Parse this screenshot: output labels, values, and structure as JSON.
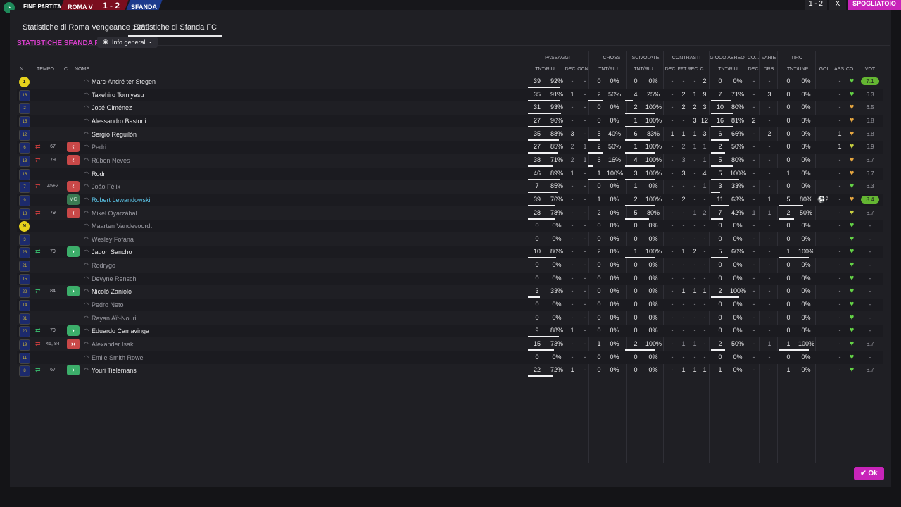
{
  "topbar": {
    "label": "FINE PARTITA",
    "home": "ROMA V",
    "score": "1 - 2",
    "away": "SFANDA",
    "right_score": "1 - 2",
    "right_x": "X",
    "right_btn": "SPOGLIATOIO"
  },
  "tabs": [
    {
      "label": "Statistiche di Roma Vengeance 1989",
      "active": false
    },
    {
      "label": "Statistiche di Sfanda FC",
      "active": true
    }
  ],
  "section_title": "STATISTICHE SFANDA FC",
  "dropdown_label": "Info generali",
  "group_headers": [
    "PASSAGGI",
    "CROSS",
    "SCIVOLATE",
    "CONTRASTI",
    "GIOCO AEREO",
    "CO...",
    "VARIE",
    "TIRO"
  ],
  "column_headers": {
    "n": "N.",
    "tempo": "TEMPO",
    "c": "C",
    "nome": "NOME",
    "pass_tr": "TNT/RIU",
    "pass_dec": "DEC",
    "pass_ocn": "OCN",
    "cross_tr": "TNT/RIU",
    "sciv_tr": "TNT/RIU",
    "con_dec": "DEC",
    "con_fft": "FFT",
    "con_rec": "REC",
    "con_c": "C...",
    "aer_tr": "TNT/RIU",
    "co_dec": "DEC",
    "var_drb": "DRB",
    "tiro_tr": "TNT/UNP",
    "gol": "GOL",
    "ass": "ASS",
    "co": "CO...",
    "voto": "VOT"
  },
  "players": [
    {
      "num": "1",
      "gk": true,
      "tempo": "",
      "sub": "",
      "badge": "",
      "name": "Marc-André ter Stegen",
      "style": "",
      "pt": "39",
      "pp": "92%",
      "pdec": "-",
      "pocn": "-",
      "ct": "0",
      "cp": "0%",
      "st": "0",
      "sp": "0%",
      "c1": "-",
      "c2": "-",
      "c3": "-",
      "c4": "2",
      "at": "0",
      "ap": "0%",
      "cdec": "-",
      "drb": "-",
      "tt": "0",
      "tp": "0%",
      "gol": "",
      "ass": "-",
      "heart": "#64d246",
      "voto": "7.1",
      "best": true,
      "pbar": 0.92,
      "cbar": 0,
      "sbar": 0,
      "abar": 0,
      "tbar": 0
    },
    {
      "num": "18",
      "gk": false,
      "tempo": "",
      "sub": "",
      "badge": "",
      "name": "Takehiro Tomiyasu",
      "style": "",
      "pt": "35",
      "pp": "91%",
      "pdec": "1",
      "pocn": "-",
      "ct": "2",
      "cp": "50%",
      "st": "4",
      "sp": "25%",
      "c1": "-",
      "c2": "2",
      "c3": "1",
      "c4": "9",
      "at": "7",
      "ap": "71%",
      "cdec": "-",
      "drb": "3",
      "tt": "0",
      "tp": "0%",
      "gol": "",
      "ass": "-",
      "heart": "#64d246",
      "voto": "6.3",
      "best": false,
      "pbar": 0.91,
      "cbar": 0.5,
      "sbar": 0.25,
      "abar": 0.71,
      "tbar": 0
    },
    {
      "num": "2",
      "gk": false,
      "tempo": "",
      "sub": "",
      "badge": "",
      "name": "José Giménez",
      "style": "",
      "pt": "31",
      "pp": "93%",
      "pdec": "-",
      "pocn": "-",
      "ct": "0",
      "cp": "0%",
      "st": "2",
      "sp": "100%",
      "c1": "-",
      "c2": "2",
      "c3": "2",
      "c4": "3",
      "at": "10",
      "ap": "80%",
      "cdec": "-",
      "drb": "-",
      "tt": "0",
      "tp": "0%",
      "gol": "",
      "ass": "-",
      "heart": "#e6a640",
      "voto": "6.5",
      "best": false,
      "pbar": 0.93,
      "cbar": 0,
      "sbar": 1,
      "abar": 0.8,
      "tbar": 0
    },
    {
      "num": "15",
      "gk": false,
      "tempo": "",
      "sub": "",
      "badge": "",
      "name": "Alessandro Bastoni",
      "style": "",
      "pt": "27",
      "pp": "96%",
      "pdec": "-",
      "pocn": "-",
      "ct": "0",
      "cp": "0%",
      "st": "1",
      "sp": "100%",
      "c1": "-",
      "c2": "-",
      "c3": "3",
      "c4": "12",
      "at": "16",
      "ap": "81%",
      "cdec": "2",
      "drb": "-",
      "tt": "0",
      "tp": "0%",
      "gol": "",
      "ass": "-",
      "heart": "#e6a640",
      "voto": "6.8",
      "best": false,
      "pbar": 0.96,
      "cbar": 0,
      "sbar": 1,
      "abar": 0.81,
      "tbar": 0
    },
    {
      "num": "12",
      "gk": false,
      "tempo": "",
      "sub": "",
      "badge": "",
      "name": "Sergio Reguilón",
      "style": "",
      "pt": "35",
      "pp": "88%",
      "pdec": "3",
      "pocn": "-",
      "ct": "5",
      "cp": "40%",
      "st": "6",
      "sp": "83%",
      "c1": "1",
      "c2": "1",
      "c3": "1",
      "c4": "3",
      "at": "6",
      "ap": "66%",
      "cdec": "-",
      "drb": "2",
      "tt": "0",
      "tp": "0%",
      "gol": "",
      "ass": "1",
      "heart": "#e6a640",
      "voto": "6.8",
      "best": false,
      "pbar": 0.88,
      "cbar": 0.4,
      "sbar": 0.83,
      "abar": 0.66,
      "tbar": 0
    },
    {
      "num": "6",
      "gk": false,
      "tempo": "67",
      "sub": "out",
      "badge": "out",
      "name": "Pedri",
      "style": "dim",
      "pt": "27",
      "pp": "85%",
      "pdec": "2",
      "pocn": "1",
      "ct": "2",
      "cp": "50%",
      "st": "1",
      "sp": "100%",
      "c1": "-",
      "c2": "2",
      "c3": "1",
      "c4": "1",
      "at": "2",
      "ap": "50%",
      "cdec": "-",
      "drb": "-",
      "tt": "0",
      "tp": "0%",
      "gol": "",
      "ass": "1",
      "heart": "#c8d040",
      "voto": "6.9",
      "best": false,
      "pbar": 0.85,
      "cbar": 0.5,
      "sbar": 1,
      "abar": 0.5,
      "tbar": 0
    },
    {
      "num": "13",
      "gk": false,
      "tempo": "79",
      "sub": "out",
      "badge": "out",
      "name": "Rúben Neves",
      "style": "dim",
      "pt": "38",
      "pp": "71%",
      "pdec": "2",
      "pocn": "1",
      "ct": "6",
      "cp": "16%",
      "st": "4",
      "sp": "100%",
      "c1": "-",
      "c2": "3",
      "c3": "-",
      "c4": "1",
      "at": "5",
      "ap": "80%",
      "cdec": "-",
      "drb": "-",
      "tt": "0",
      "tp": "0%",
      "gol": "",
      "ass": "-",
      "heart": "#e6a640",
      "voto": "6.7",
      "best": false,
      "pbar": 0.71,
      "cbar": 0.16,
      "sbar": 1,
      "abar": 0.8,
      "tbar": 0
    },
    {
      "num": "16",
      "gk": false,
      "tempo": "",
      "sub": "",
      "badge": "",
      "name": "Rodri",
      "style": "",
      "pt": "46",
      "pp": "89%",
      "pdec": "1",
      "pocn": "-",
      "ct": "1",
      "cp": "100%",
      "st": "3",
      "sp": "100%",
      "c1": "-",
      "c2": "3",
      "c3": "-",
      "c4": "4",
      "at": "5",
      "ap": "100%",
      "cdec": "-",
      "drb": "-",
      "tt": "1",
      "tp": "0%",
      "gol": "",
      "ass": "-",
      "heart": "#e6a640",
      "voto": "6.7",
      "best": false,
      "pbar": 0.89,
      "cbar": 1,
      "sbar": 1,
      "abar": 1,
      "tbar": 0
    },
    {
      "num": "7",
      "gk": false,
      "tempo": "45+2",
      "sub": "out",
      "badge": "out",
      "name": "João Félix",
      "style": "dim",
      "pt": "7",
      "pp": "85%",
      "pdec": "-",
      "pocn": "-",
      "ct": "0",
      "cp": "0%",
      "st": "1",
      "sp": "0%",
      "c1": "-",
      "c2": "-",
      "c3": "-",
      "c4": "1",
      "at": "3",
      "ap": "33%",
      "cdec": "-",
      "drb": "-",
      "tt": "0",
      "tp": "0%",
      "gol": "",
      "ass": "-",
      "heart": "#64d246",
      "voto": "6.3",
      "best": false,
      "pbar": 0.85,
      "cbar": 0,
      "sbar": 0,
      "abar": 0.33,
      "tbar": 0
    },
    {
      "num": "9",
      "gk": false,
      "tempo": "",
      "sub": "",
      "badge": "mc",
      "name": "Robert Lewandowski",
      "style": "hl",
      "pt": "39",
      "pp": "76%",
      "pdec": "-",
      "pocn": "-",
      "ct": "1",
      "cp": "0%",
      "st": "2",
      "sp": "100%",
      "c1": "-",
      "c2": "2",
      "c3": "-",
      "c4": "-",
      "at": "11",
      "ap": "63%",
      "cdec": "-",
      "drb": "1",
      "tt": "5",
      "tp": "80%",
      "gol": "2",
      "ass": "-",
      "heart": "#e6a640",
      "voto": "8.4",
      "best": true,
      "pbar": 0.76,
      "cbar": 0,
      "sbar": 1,
      "abar": 0.63,
      "tbar": 0.8
    },
    {
      "num": "18",
      "gk": false,
      "tempo": "79",
      "sub": "out",
      "badge": "out",
      "name": "Mikel Oyarzábal",
      "style": "dim",
      "pt": "28",
      "pp": "78%",
      "pdec": "-",
      "pocn": "-",
      "ct": "2",
      "cp": "0%",
      "st": "5",
      "sp": "80%",
      "c1": "-",
      "c2": "-",
      "c3": "1",
      "c4": "2",
      "at": "7",
      "ap": "42%",
      "cdec": "1",
      "drb": "1",
      "tt": "2",
      "tp": "50%",
      "gol": "",
      "ass": "-",
      "heart": "#c8d040",
      "voto": "6.7",
      "best": false,
      "pbar": 0.78,
      "cbar": 0,
      "sbar": 0.8,
      "abar": 0.42,
      "tbar": 0.5
    },
    {
      "num": "N",
      "gk": true,
      "tempo": "",
      "sub": "",
      "badge": "",
      "name": "Maarten Vandevoordt",
      "style": "dim",
      "pt": "0",
      "pp": "0%",
      "pdec": "-",
      "pocn": "-",
      "ct": "0",
      "cp": "0%",
      "st": "0",
      "sp": "0%",
      "c1": "-",
      "c2": "-",
      "c3": "-",
      "c4": "-",
      "at": "0",
      "ap": "0%",
      "cdec": "-",
      "drb": "-",
      "tt": "0",
      "tp": "0%",
      "gol": "",
      "ass": "-",
      "heart": "#64d246",
      "voto": "-",
      "best": false,
      "pbar": 0,
      "cbar": 0,
      "sbar": 0,
      "abar": 0,
      "tbar": 0
    },
    {
      "num": "3",
      "gk": false,
      "tempo": "",
      "sub": "",
      "badge": "",
      "name": "Wesley Fofana",
      "style": "dim",
      "pt": "0",
      "pp": "0%",
      "pdec": "-",
      "pocn": "-",
      "ct": "0",
      "cp": "0%",
      "st": "0",
      "sp": "0%",
      "c1": "-",
      "c2": "-",
      "c3": "-",
      "c4": "-",
      "at": "0",
      "ap": "0%",
      "cdec": "-",
      "drb": "-",
      "tt": "0",
      "tp": "0%",
      "gol": "",
      "ass": "-",
      "heart": "#64d246",
      "voto": "-",
      "best": false,
      "pbar": 0,
      "cbar": 0,
      "sbar": 0,
      "abar": 0,
      "tbar": 0
    },
    {
      "num": "23",
      "gk": false,
      "tempo": "79",
      "sub": "in",
      "badge": "in",
      "name": "Jadon Sancho",
      "style": "",
      "pt": "10",
      "pp": "80%",
      "pdec": "-",
      "pocn": "-",
      "ct": "2",
      "cp": "0%",
      "st": "1",
      "sp": "100%",
      "c1": "-",
      "c2": "1",
      "c3": "2",
      "c4": "-",
      "at": "5",
      "ap": "60%",
      "cdec": "-",
      "drb": "-",
      "tt": "1",
      "tp": "100%",
      "gol": "",
      "ass": "-",
      "heart": "#64d246",
      "voto": "-",
      "best": false,
      "pbar": 0.8,
      "cbar": 0,
      "sbar": 1,
      "abar": 0.6,
      "tbar": 1
    },
    {
      "num": "21",
      "gk": false,
      "tempo": "",
      "sub": "",
      "badge": "",
      "name": "Rodrygo",
      "style": "dim",
      "pt": "0",
      "pp": "0%",
      "pdec": "-",
      "pocn": "-",
      "ct": "0",
      "cp": "0%",
      "st": "0",
      "sp": "0%",
      "c1": "-",
      "c2": "-",
      "c3": "-",
      "c4": "-",
      "at": "0",
      "ap": "0%",
      "cdec": "-",
      "drb": "-",
      "tt": "0",
      "tp": "0%",
      "gol": "",
      "ass": "-",
      "heart": "#64d246",
      "voto": "-",
      "best": false,
      "pbar": 0,
      "cbar": 0,
      "sbar": 0,
      "abar": 0,
      "tbar": 0
    },
    {
      "num": "15",
      "gk": false,
      "tempo": "",
      "sub": "",
      "badge": "",
      "name": "Devyne Rensch",
      "style": "dim",
      "pt": "0",
      "pp": "0%",
      "pdec": "-",
      "pocn": "-",
      "ct": "0",
      "cp": "0%",
      "st": "0",
      "sp": "0%",
      "c1": "-",
      "c2": "-",
      "c3": "-",
      "c4": "-",
      "at": "0",
      "ap": "0%",
      "cdec": "-",
      "drb": "-",
      "tt": "0",
      "tp": "0%",
      "gol": "",
      "ass": "-",
      "heart": "#64d246",
      "voto": "-",
      "best": false,
      "pbar": 0,
      "cbar": 0,
      "sbar": 0,
      "abar": 0,
      "tbar": 0
    },
    {
      "num": "22",
      "gk": false,
      "tempo": "84",
      "sub": "in",
      "badge": "in",
      "name": "Nicolò Zaniolo",
      "style": "",
      "pt": "3",
      "pp": "33%",
      "pdec": "-",
      "pocn": "-",
      "ct": "0",
      "cp": "0%",
      "st": "0",
      "sp": "0%",
      "c1": "-",
      "c2": "1",
      "c3": "1",
      "c4": "1",
      "at": "2",
      "ap": "100%",
      "cdec": "-",
      "drb": "-",
      "tt": "0",
      "tp": "0%",
      "gol": "",
      "ass": "-",
      "heart": "#64d246",
      "voto": "-",
      "best": false,
      "pbar": 0.33,
      "cbar": 0,
      "sbar": 0,
      "abar": 1,
      "tbar": 0
    },
    {
      "num": "14",
      "gk": false,
      "tempo": "",
      "sub": "",
      "badge": "",
      "name": "Pedro Neto",
      "style": "dim",
      "pt": "0",
      "pp": "0%",
      "pdec": "-",
      "pocn": "-",
      "ct": "0",
      "cp": "0%",
      "st": "0",
      "sp": "0%",
      "c1": "-",
      "c2": "-",
      "c3": "-",
      "c4": "-",
      "at": "0",
      "ap": "0%",
      "cdec": "-",
      "drb": "-",
      "tt": "0",
      "tp": "0%",
      "gol": "",
      "ass": "-",
      "heart": "#64d246",
      "voto": "-",
      "best": false,
      "pbar": 0,
      "cbar": 0,
      "sbar": 0,
      "abar": 0,
      "tbar": 0
    },
    {
      "num": "31",
      "gk": false,
      "tempo": "",
      "sub": "",
      "badge": "",
      "name": "Rayan Aït-Nouri",
      "style": "dim",
      "pt": "0",
      "pp": "0%",
      "pdec": "-",
      "pocn": "-",
      "ct": "0",
      "cp": "0%",
      "st": "0",
      "sp": "0%",
      "c1": "-",
      "c2": "-",
      "c3": "-",
      "c4": "-",
      "at": "0",
      "ap": "0%",
      "cdec": "-",
      "drb": "-",
      "tt": "0",
      "tp": "0%",
      "gol": "",
      "ass": "-",
      "heart": "#64d246",
      "voto": "-",
      "best": false,
      "pbar": 0,
      "cbar": 0,
      "sbar": 0,
      "abar": 0,
      "tbar": 0
    },
    {
      "num": "20",
      "gk": false,
      "tempo": "79",
      "sub": "in",
      "badge": "in",
      "name": "Eduardo Camavinga",
      "style": "",
      "pt": "9",
      "pp": "88%",
      "pdec": "1",
      "pocn": "-",
      "ct": "0",
      "cp": "0%",
      "st": "0",
      "sp": "0%",
      "c1": "-",
      "c2": "-",
      "c3": "-",
      "c4": "-",
      "at": "0",
      "ap": "0%",
      "cdec": "-",
      "drb": "-",
      "tt": "0",
      "tp": "0%",
      "gol": "",
      "ass": "-",
      "heart": "#64d246",
      "voto": "-",
      "best": false,
      "pbar": 0.88,
      "cbar": 0,
      "sbar": 0,
      "abar": 0,
      "tbar": 0
    },
    {
      "num": "19",
      "gk": false,
      "tempo": "45, 84",
      "sub": "inout",
      "badge": "inout",
      "name": "Alexander Isak",
      "style": "dim",
      "pt": "15",
      "pp": "73%",
      "pdec": "-",
      "pocn": "-",
      "ct": "1",
      "cp": "0%",
      "st": "2",
      "sp": "100%",
      "c1": "-",
      "c2": "1",
      "c3": "1",
      "c4": "-",
      "at": "2",
      "ap": "50%",
      "cdec": "-",
      "drb": "1",
      "tt": "1",
      "tp": "100%",
      "gol": "",
      "ass": "-",
      "heart": "#64d246",
      "voto": "6.7",
      "best": false,
      "pbar": 0.73,
      "cbar": 0,
      "sbar": 1,
      "abar": 0.5,
      "tbar": 1
    },
    {
      "num": "11",
      "gk": false,
      "tempo": "",
      "sub": "",
      "badge": "",
      "name": "Emile Smith Rowe",
      "style": "dim",
      "pt": "0",
      "pp": "0%",
      "pdec": "-",
      "pocn": "-",
      "ct": "0",
      "cp": "0%",
      "st": "0",
      "sp": "0%",
      "c1": "-",
      "c2": "-",
      "c3": "-",
      "c4": "-",
      "at": "0",
      "ap": "0%",
      "cdec": "-",
      "drb": "-",
      "tt": "0",
      "tp": "0%",
      "gol": "",
      "ass": "-",
      "heart": "#64d246",
      "voto": "-",
      "best": false,
      "pbar": 0,
      "cbar": 0,
      "sbar": 0,
      "abar": 0,
      "tbar": 0
    },
    {
      "num": "8",
      "gk": false,
      "tempo": "67",
      "sub": "in",
      "badge": "in",
      "name": "Youri Tielemans",
      "style": "",
      "pt": "22",
      "pp": "72%",
      "pdec": "1",
      "pocn": "-",
      "ct": "0",
      "cp": "0%",
      "st": "0",
      "sp": "0%",
      "c1": "-",
      "c2": "1",
      "c3": "1",
      "c4": "1",
      "at": "1",
      "ap": "0%",
      "cdec": "-",
      "drb": "-",
      "tt": "1",
      "tp": "0%",
      "gol": "",
      "ass": "-",
      "heart": "#64d246",
      "voto": "6.7",
      "best": false,
      "pbar": 0.72,
      "cbar": 0,
      "sbar": 0,
      "abar": 0,
      "tbar": 0
    }
  ],
  "ok_label": "Ok",
  "colors": {
    "accent": "#c824b9",
    "title": "#d63fc9",
    "best": "#64b632"
  }
}
